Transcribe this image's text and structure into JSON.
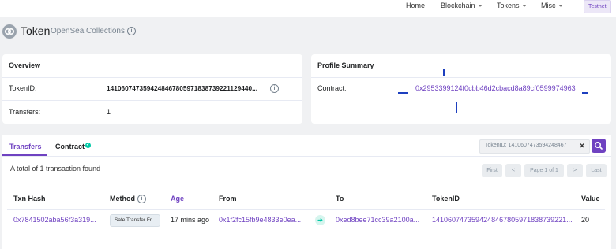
{
  "nav": {
    "home": "Home",
    "blockchain": "Blockchain",
    "tokens": "Tokens",
    "misc": "Misc",
    "network_badge": "Testnet"
  },
  "page": {
    "title": "Token",
    "subtitle": "OpenSea Collections"
  },
  "overview": {
    "heading": "Overview",
    "token_id_label": "TokenID:",
    "token_id_value": "14106074735942484678059718387392211294​40...",
    "transfers_label": "Transfers:",
    "transfers_value": "1"
  },
  "profile": {
    "heading": "Profile Summary",
    "contract_label": "Contract:",
    "contract_value": "0x2953399124f0cbb46d2cbacd8a89cf0599974963"
  },
  "tabs": {
    "transfers": "Transfers",
    "contract": "Contract",
    "search_value": "TokenID: 1410607473594248467"
  },
  "transfers": {
    "summary": "A total of 1 transaction found",
    "pagination": {
      "first": "First",
      "prev": "<",
      "page": "Page 1 of 1",
      "next": ">",
      "last": "Last"
    },
    "columns": {
      "txn_hash": "Txn Hash",
      "method": "Method",
      "age": "Age",
      "from": "From",
      "to": "To",
      "token_id": "TokenID",
      "value": "Value"
    },
    "rows": [
      {
        "txn_hash": "0x7841502aba56f3a319...",
        "method": "Safe Transfer Fr...",
        "age": "17 mins ago",
        "from": "0x1f2fc15fb9e4833e0ea...",
        "to": "0xed8bee71cc39a2100a...",
        "token_id": "141060747359424846780597183873922​1...",
        "value": "20"
      }
    ]
  },
  "colors": {
    "accent": "#6f42c1",
    "success": "#00c9a7",
    "background": "#f0f1f3"
  },
  "icons": [
    "logo-icon",
    "info-icon",
    "caret-down-icon",
    "check-icon",
    "close-icon",
    "search-icon",
    "arrow-right-icon"
  ]
}
